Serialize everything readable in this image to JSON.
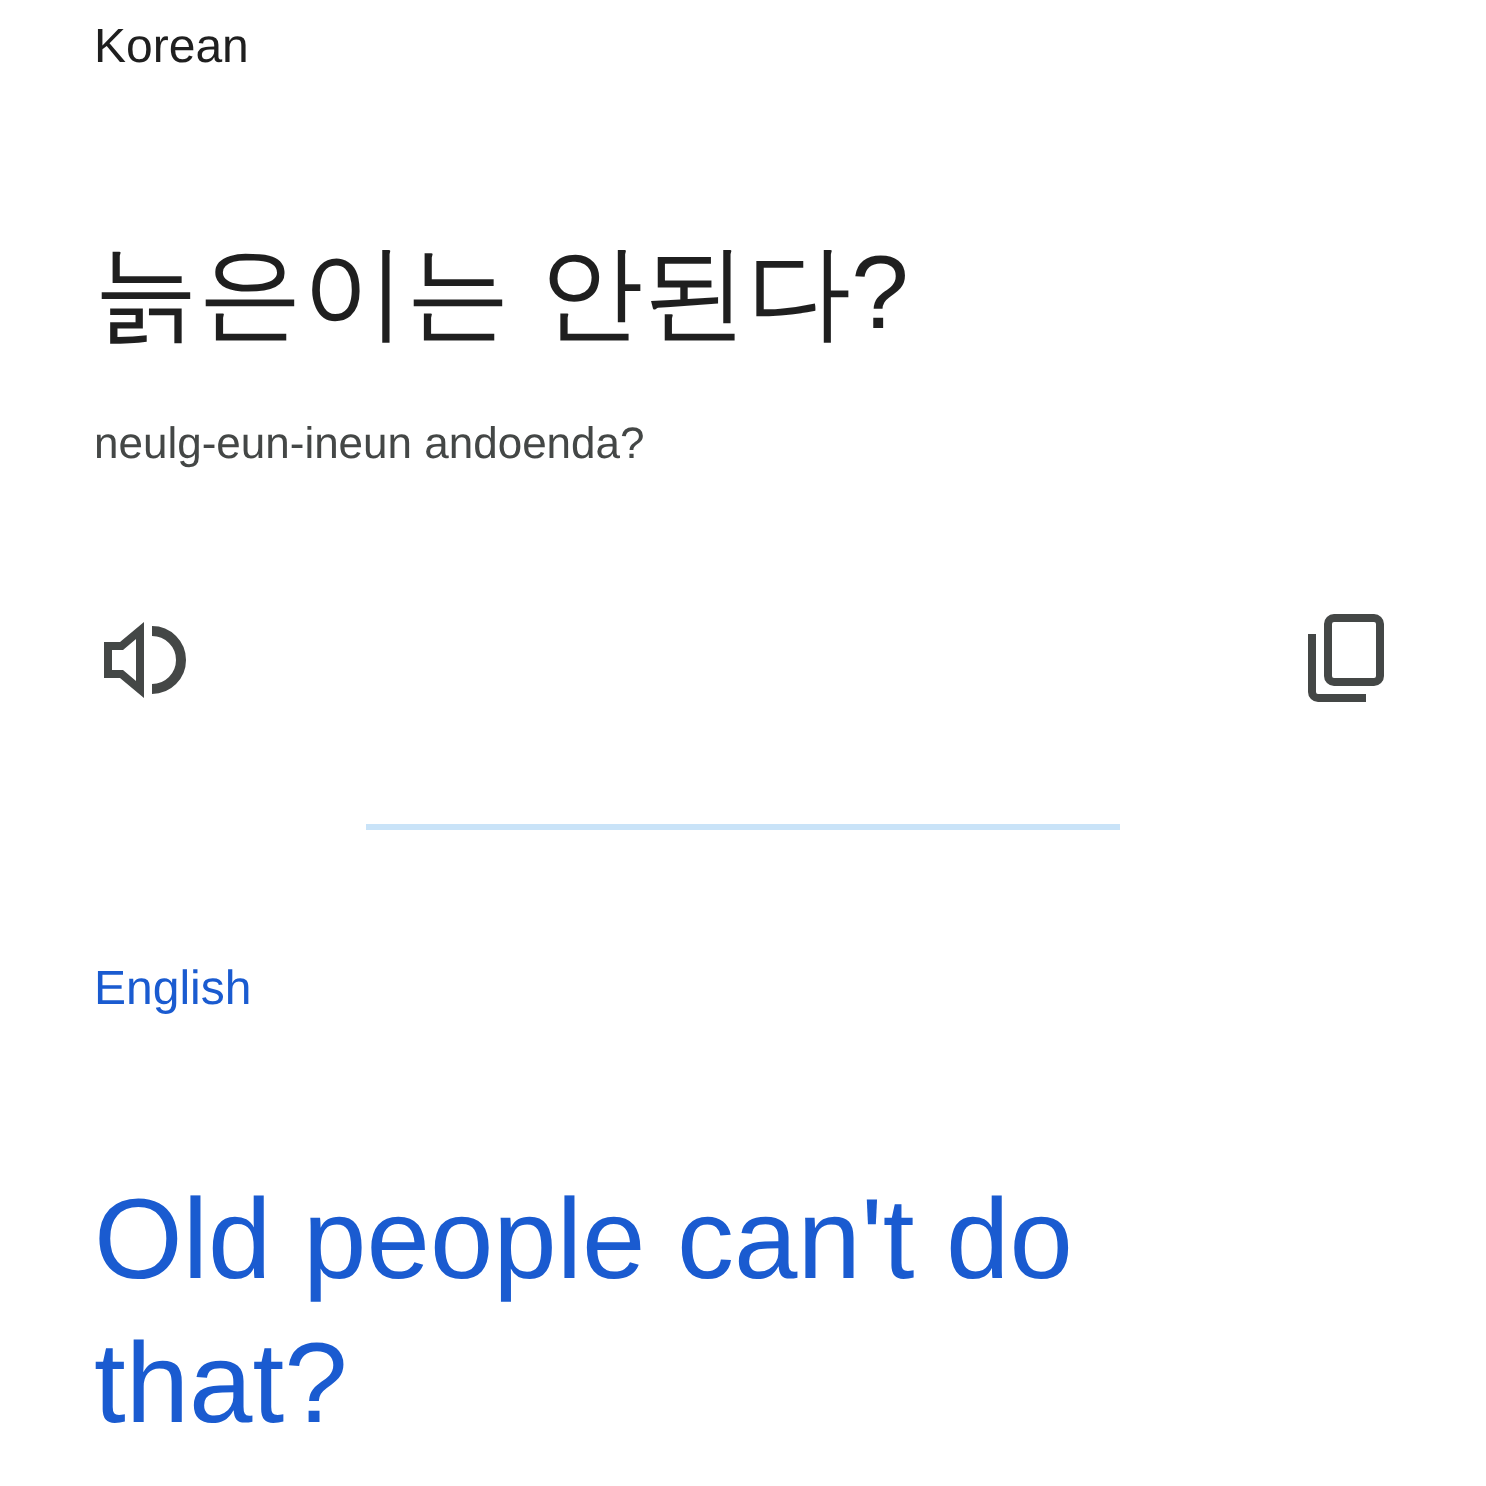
{
  "source": {
    "language": "Korean",
    "text": "늙은이는 안된다?",
    "romanization": "neulg-eun-ineun andoenda?"
  },
  "target": {
    "language": "English",
    "text": "Old people can't do that?"
  }
}
